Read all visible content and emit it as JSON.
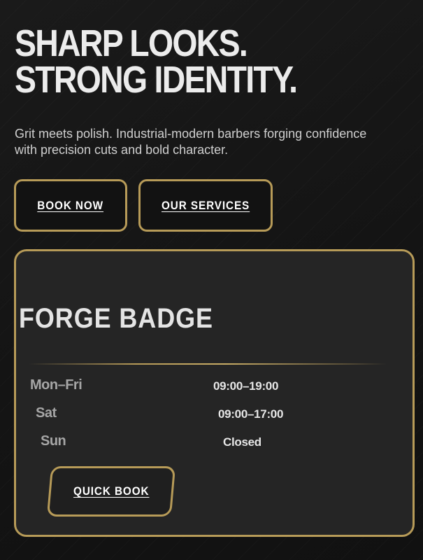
{
  "hero": {
    "title_line1": "SHARP LOOKS.",
    "title_line2": "STRONG IDENTITY.",
    "subtitle": "Grit meets polish. Industrial-modern barbers forging confidence with precision cuts and bold character."
  },
  "actions": {
    "book_label": "BOOK NOW",
    "services_label": "OUR SERVICES"
  },
  "badge": {
    "title": "FORGE BADGE",
    "hours": [
      {
        "day": "Mon–Fri",
        "time": "09:00–19:00"
      },
      {
        "day": "Sat",
        "time": "09:00–17:00"
      },
      {
        "day": "Sun",
        "time": "Closed"
      }
    ],
    "quick_book_label": "QUICK BOOK"
  },
  "colors": {
    "accent_gold": "#b79b58",
    "background": "#141414",
    "card": "#252525"
  }
}
